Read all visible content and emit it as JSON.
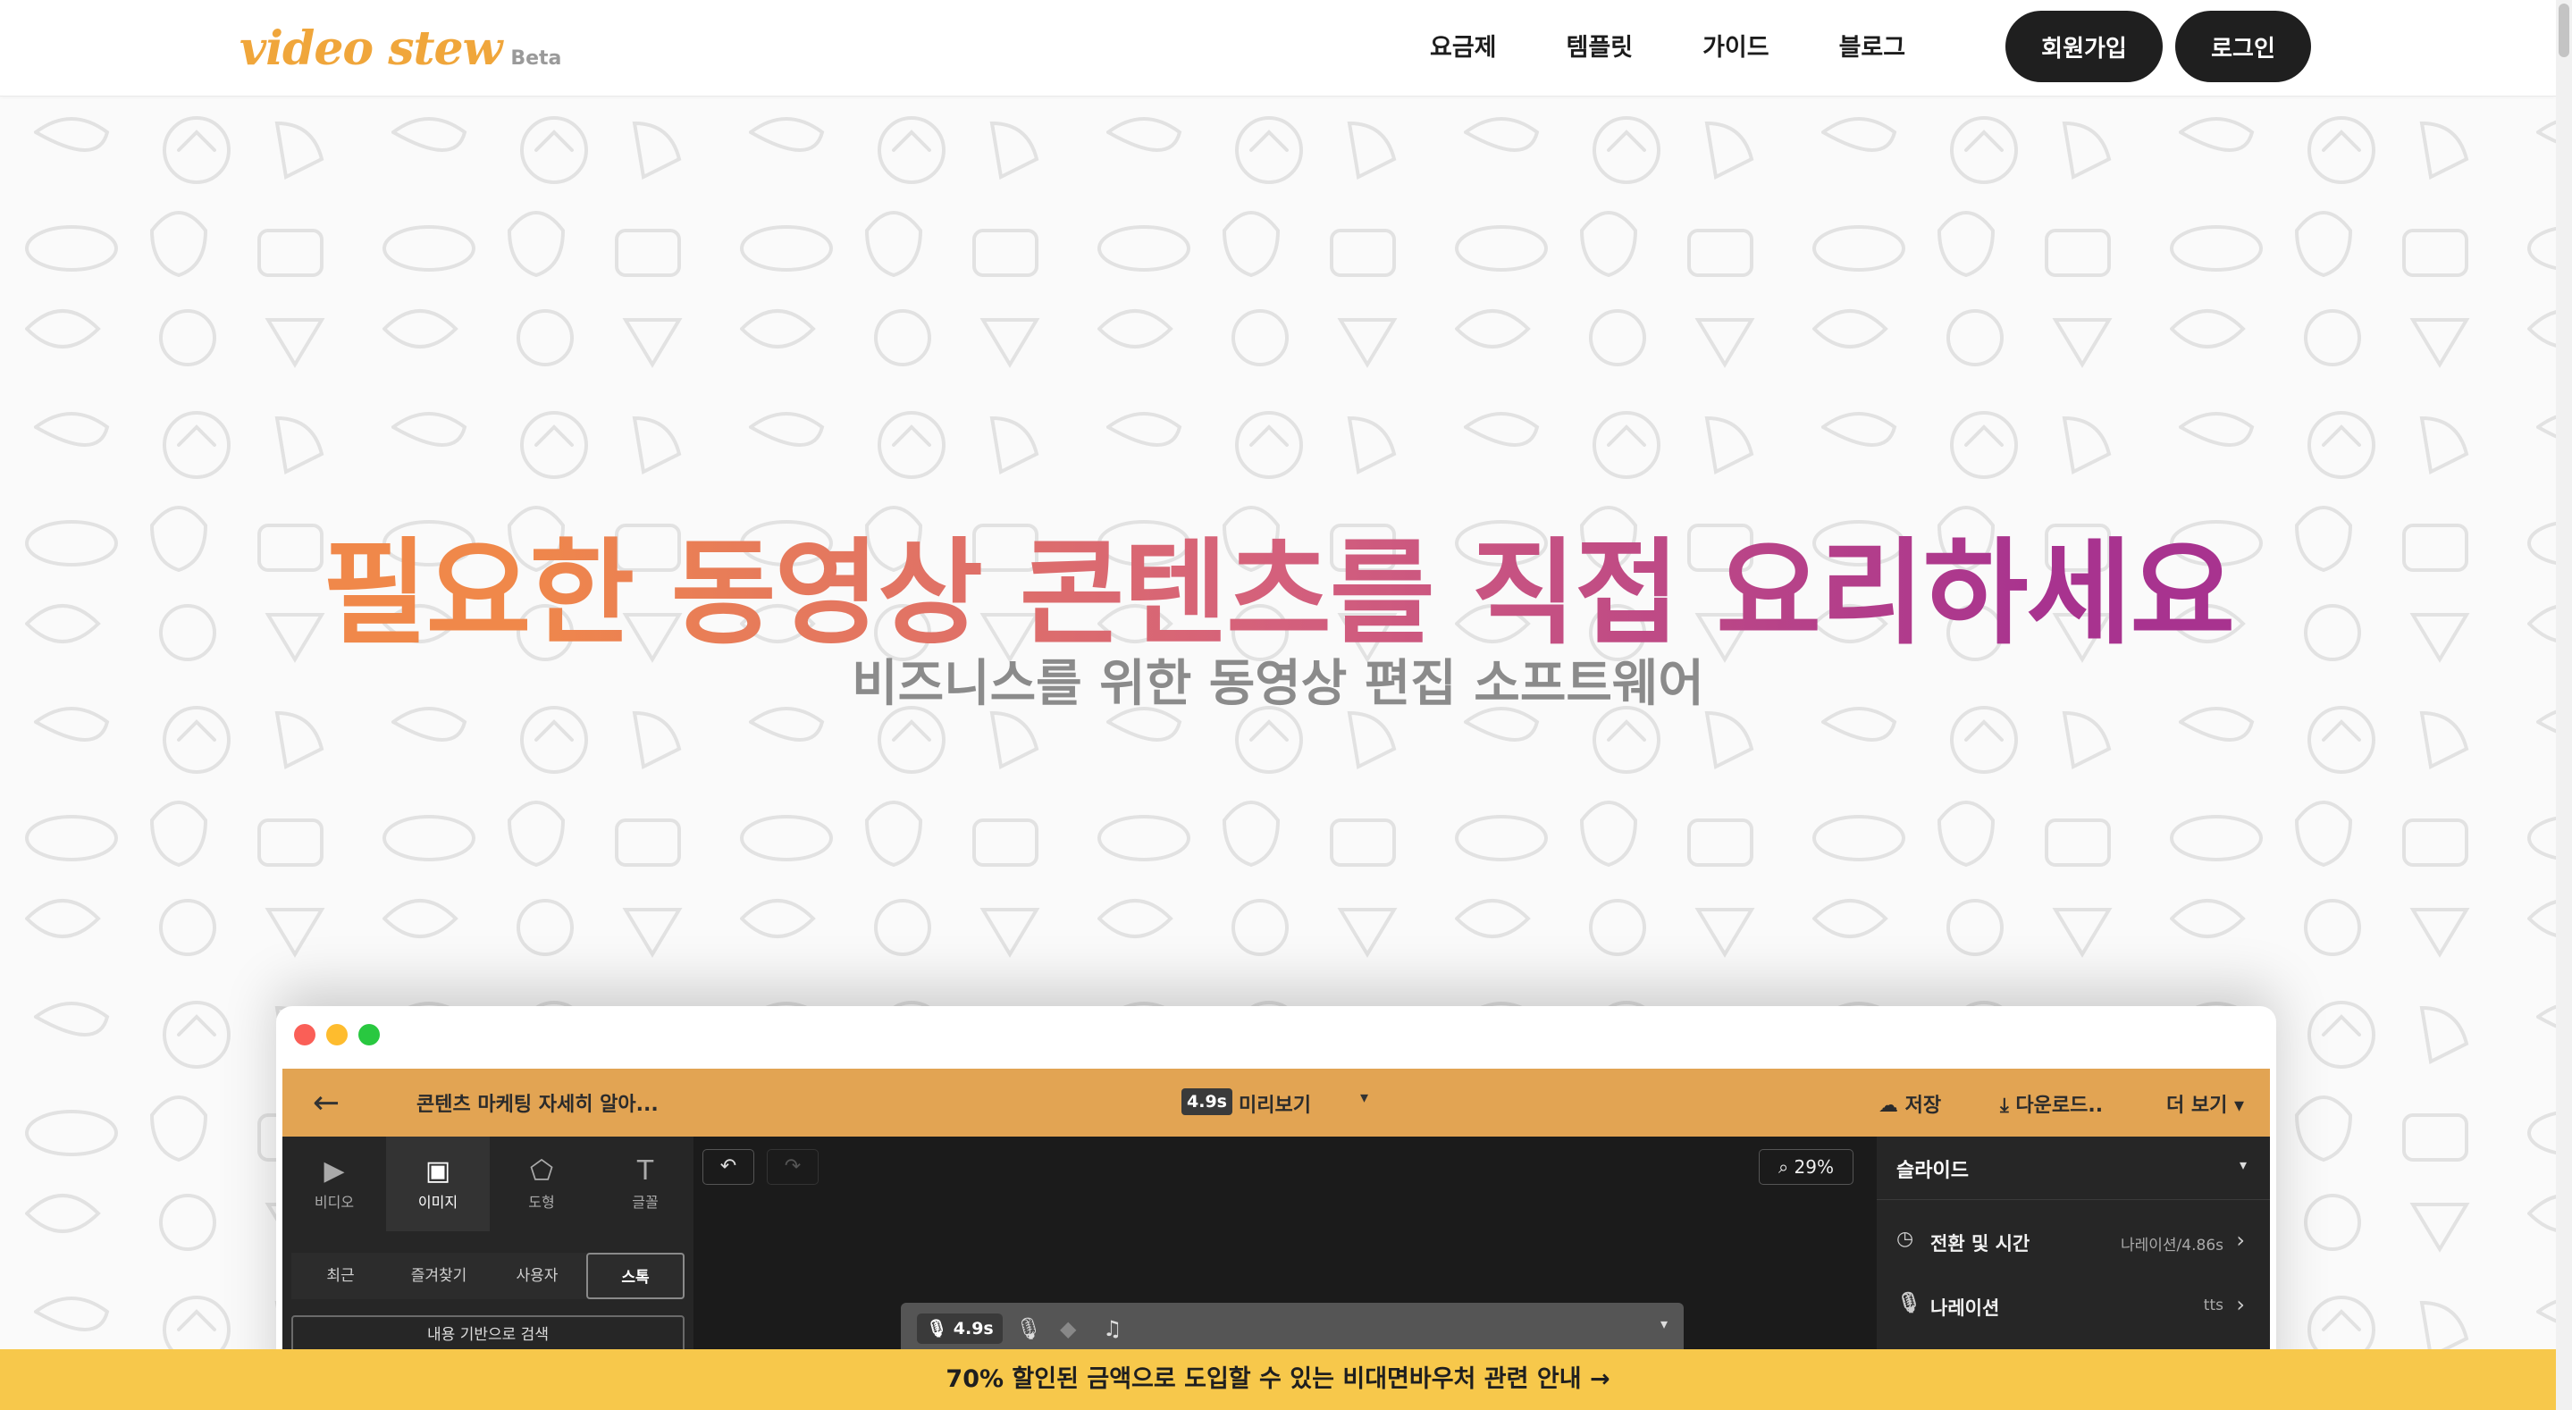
{
  "header": {
    "logo": "video stew",
    "beta": "Beta",
    "nav": [
      "요금제",
      "템플릿",
      "가이드",
      "블로그"
    ],
    "signup": "회원가입",
    "login": "로그인"
  },
  "hero": {
    "title": "필요한 동영상 콘텐츠를 직접 요리하세요",
    "subtitle": "비즈니스를 위한 동영상 편집 소프트웨어"
  },
  "app": {
    "title": "콘텐츠 마케팅 자세히 알아...",
    "duration": "4.9s",
    "preview": "미리보기",
    "save": "저장",
    "download": "다운로드..",
    "more": "더 보기",
    "tools": [
      {
        "label": "비디오",
        "icon": "video-icon"
      },
      {
        "label": "이미지",
        "icon": "image-icon"
      },
      {
        "label": "도형",
        "icon": "shape-icon"
      },
      {
        "label": "글꼴",
        "icon": "text-icon"
      }
    ],
    "sub_tabs": [
      "최근",
      "즐겨찾기",
      "사용자",
      "스톡"
    ],
    "search": "내용 기반으로 검색",
    "zoom": "29%",
    "timeline_duration": "4.9s",
    "panel_title": "슬라이드",
    "panel_rows": [
      {
        "label": "전환 및 시간",
        "value": "나레이션/4.86s",
        "icon": "clock-icon"
      },
      {
        "label": "나레이션",
        "value": "tts",
        "icon": "microphone-icon"
      }
    ]
  },
  "promo": "70% 할인된 금액으로 도입할 수 있는 비대면바우처 관련 안내 →",
  "colors": {
    "brand": "#f0a63b",
    "app_bar": "#e2a453",
    "promo_bg": "#f7c84b",
    "gradient_start": "#f0884a",
    "gradient_end": "#a8338f"
  }
}
